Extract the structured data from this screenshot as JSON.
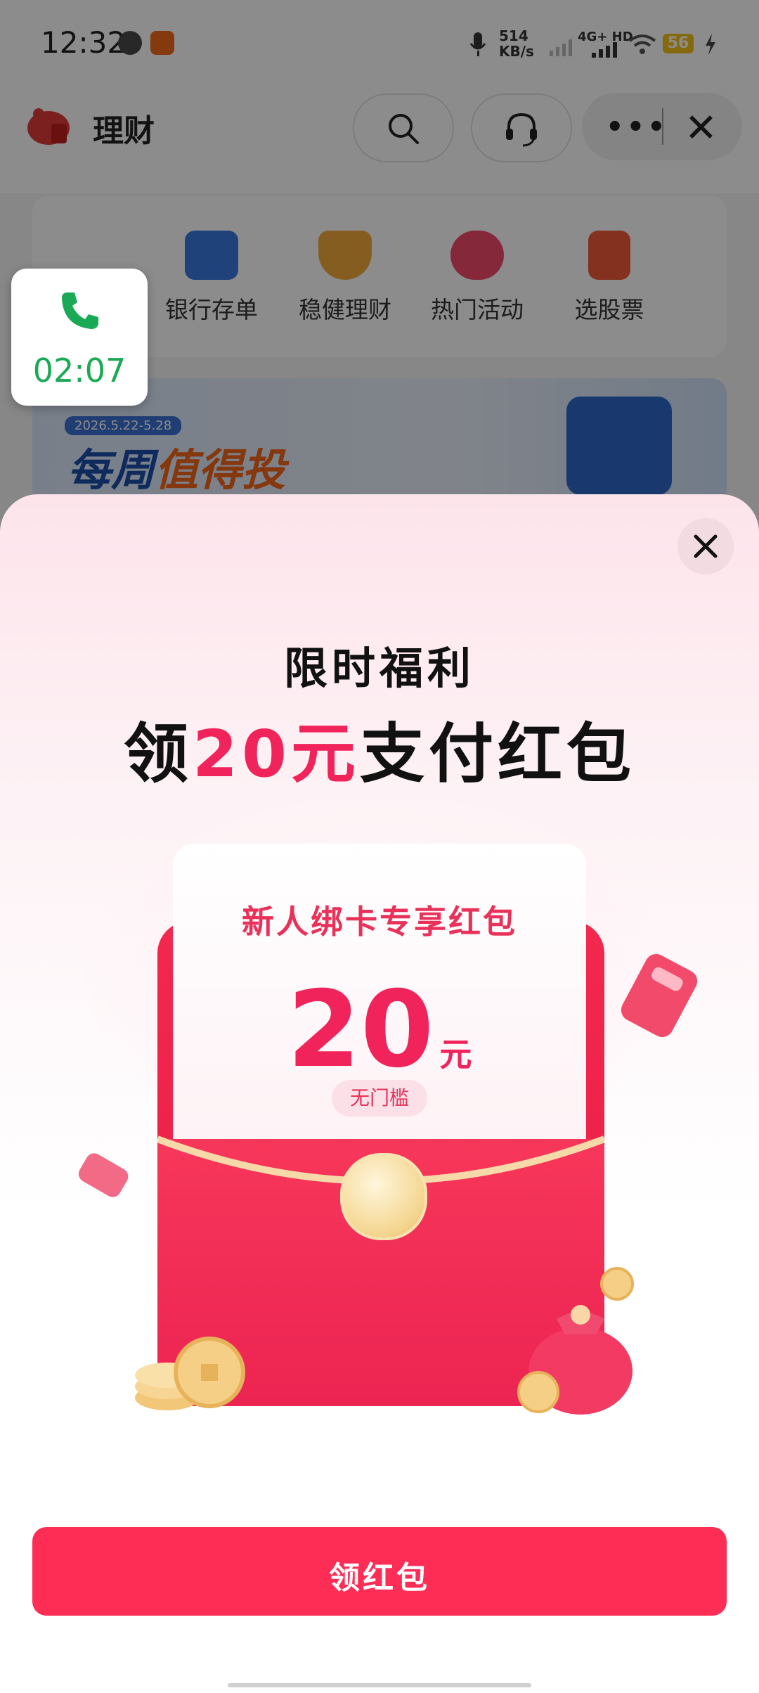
{
  "status_bar": {
    "time": "12:32",
    "net_speed_value": "514",
    "net_speed_unit": "KB/s",
    "network": "4G+ HD",
    "battery": "56"
  },
  "app_bar": {
    "title": "理财",
    "icons": [
      "search-icon",
      "headset-icon",
      "more-icon",
      "close-icon"
    ]
  },
  "quick_menu": [
    {
      "label": "银行存单",
      "icon": "bank-card-icon",
      "color": "#3a78e0"
    },
    {
      "label": "稳健理财",
      "icon": "shield-yuan-icon",
      "color": "#f2a93b"
    },
    {
      "label": "热门活动",
      "icon": "flame-icon",
      "color": "#f04a6a"
    },
    {
      "label": "选股票",
      "icon": "candlestick-icon",
      "color": "#f05a3a"
    }
  ],
  "banner": {
    "date": "2026.5.22-5.28",
    "title_part1": "每周",
    "title_part2": "值得投"
  },
  "call_widget": {
    "duration": "02:07"
  },
  "promo": {
    "subtitle": "限时福利",
    "headline_prefix": "领",
    "headline_amount": "20元",
    "headline_suffix": "支付红包",
    "card_title": "新人绑卡专享红包",
    "card_amount": "20",
    "card_unit": "元",
    "card_tag": "无门槛",
    "cta_label": "领红包",
    "accent_color": "#f0245b"
  }
}
